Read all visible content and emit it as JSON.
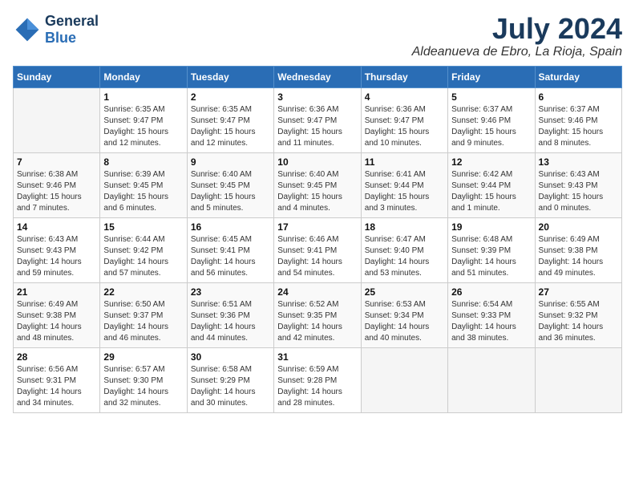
{
  "header": {
    "logo_line1": "General",
    "logo_line2": "Blue",
    "month_year": "July 2024",
    "location": "Aldeanueva de Ebro, La Rioja, Spain"
  },
  "days_of_week": [
    "Sunday",
    "Monday",
    "Tuesday",
    "Wednesday",
    "Thursday",
    "Friday",
    "Saturday"
  ],
  "weeks": [
    [
      {
        "num": "",
        "sunrise": "",
        "sunset": "",
        "daylight": ""
      },
      {
        "num": "1",
        "sunrise": "Sunrise: 6:35 AM",
        "sunset": "Sunset: 9:47 PM",
        "daylight": "Daylight: 15 hours and 12 minutes."
      },
      {
        "num": "2",
        "sunrise": "Sunrise: 6:35 AM",
        "sunset": "Sunset: 9:47 PM",
        "daylight": "Daylight: 15 hours and 12 minutes."
      },
      {
        "num": "3",
        "sunrise": "Sunrise: 6:36 AM",
        "sunset": "Sunset: 9:47 PM",
        "daylight": "Daylight: 15 hours and 11 minutes."
      },
      {
        "num": "4",
        "sunrise": "Sunrise: 6:36 AM",
        "sunset": "Sunset: 9:47 PM",
        "daylight": "Daylight: 15 hours and 10 minutes."
      },
      {
        "num": "5",
        "sunrise": "Sunrise: 6:37 AM",
        "sunset": "Sunset: 9:46 PM",
        "daylight": "Daylight: 15 hours and 9 minutes."
      },
      {
        "num": "6",
        "sunrise": "Sunrise: 6:37 AM",
        "sunset": "Sunset: 9:46 PM",
        "daylight": "Daylight: 15 hours and 8 minutes."
      }
    ],
    [
      {
        "num": "7",
        "sunrise": "Sunrise: 6:38 AM",
        "sunset": "Sunset: 9:46 PM",
        "daylight": "Daylight: 15 hours and 7 minutes."
      },
      {
        "num": "8",
        "sunrise": "Sunrise: 6:39 AM",
        "sunset": "Sunset: 9:45 PM",
        "daylight": "Daylight: 15 hours and 6 minutes."
      },
      {
        "num": "9",
        "sunrise": "Sunrise: 6:40 AM",
        "sunset": "Sunset: 9:45 PM",
        "daylight": "Daylight: 15 hours and 5 minutes."
      },
      {
        "num": "10",
        "sunrise": "Sunrise: 6:40 AM",
        "sunset": "Sunset: 9:45 PM",
        "daylight": "Daylight: 15 hours and 4 minutes."
      },
      {
        "num": "11",
        "sunrise": "Sunrise: 6:41 AM",
        "sunset": "Sunset: 9:44 PM",
        "daylight": "Daylight: 15 hours and 3 minutes."
      },
      {
        "num": "12",
        "sunrise": "Sunrise: 6:42 AM",
        "sunset": "Sunset: 9:44 PM",
        "daylight": "Daylight: 15 hours and 1 minute."
      },
      {
        "num": "13",
        "sunrise": "Sunrise: 6:43 AM",
        "sunset": "Sunset: 9:43 PM",
        "daylight": "Daylight: 15 hours and 0 minutes."
      }
    ],
    [
      {
        "num": "14",
        "sunrise": "Sunrise: 6:43 AM",
        "sunset": "Sunset: 9:43 PM",
        "daylight": "Daylight: 14 hours and 59 minutes."
      },
      {
        "num": "15",
        "sunrise": "Sunrise: 6:44 AM",
        "sunset": "Sunset: 9:42 PM",
        "daylight": "Daylight: 14 hours and 57 minutes."
      },
      {
        "num": "16",
        "sunrise": "Sunrise: 6:45 AM",
        "sunset": "Sunset: 9:41 PM",
        "daylight": "Daylight: 14 hours and 56 minutes."
      },
      {
        "num": "17",
        "sunrise": "Sunrise: 6:46 AM",
        "sunset": "Sunset: 9:41 PM",
        "daylight": "Daylight: 14 hours and 54 minutes."
      },
      {
        "num": "18",
        "sunrise": "Sunrise: 6:47 AM",
        "sunset": "Sunset: 9:40 PM",
        "daylight": "Daylight: 14 hours and 53 minutes."
      },
      {
        "num": "19",
        "sunrise": "Sunrise: 6:48 AM",
        "sunset": "Sunset: 9:39 PM",
        "daylight": "Daylight: 14 hours and 51 minutes."
      },
      {
        "num": "20",
        "sunrise": "Sunrise: 6:49 AM",
        "sunset": "Sunset: 9:38 PM",
        "daylight": "Daylight: 14 hours and 49 minutes."
      }
    ],
    [
      {
        "num": "21",
        "sunrise": "Sunrise: 6:49 AM",
        "sunset": "Sunset: 9:38 PM",
        "daylight": "Daylight: 14 hours and 48 minutes."
      },
      {
        "num": "22",
        "sunrise": "Sunrise: 6:50 AM",
        "sunset": "Sunset: 9:37 PM",
        "daylight": "Daylight: 14 hours and 46 minutes."
      },
      {
        "num": "23",
        "sunrise": "Sunrise: 6:51 AM",
        "sunset": "Sunset: 9:36 PM",
        "daylight": "Daylight: 14 hours and 44 minutes."
      },
      {
        "num": "24",
        "sunrise": "Sunrise: 6:52 AM",
        "sunset": "Sunset: 9:35 PM",
        "daylight": "Daylight: 14 hours and 42 minutes."
      },
      {
        "num": "25",
        "sunrise": "Sunrise: 6:53 AM",
        "sunset": "Sunset: 9:34 PM",
        "daylight": "Daylight: 14 hours and 40 minutes."
      },
      {
        "num": "26",
        "sunrise": "Sunrise: 6:54 AM",
        "sunset": "Sunset: 9:33 PM",
        "daylight": "Daylight: 14 hours and 38 minutes."
      },
      {
        "num": "27",
        "sunrise": "Sunrise: 6:55 AM",
        "sunset": "Sunset: 9:32 PM",
        "daylight": "Daylight: 14 hours and 36 minutes."
      }
    ],
    [
      {
        "num": "28",
        "sunrise": "Sunrise: 6:56 AM",
        "sunset": "Sunset: 9:31 PM",
        "daylight": "Daylight: 14 hours and 34 minutes."
      },
      {
        "num": "29",
        "sunrise": "Sunrise: 6:57 AM",
        "sunset": "Sunset: 9:30 PM",
        "daylight": "Daylight: 14 hours and 32 minutes."
      },
      {
        "num": "30",
        "sunrise": "Sunrise: 6:58 AM",
        "sunset": "Sunset: 9:29 PM",
        "daylight": "Daylight: 14 hours and 30 minutes."
      },
      {
        "num": "31",
        "sunrise": "Sunrise: 6:59 AM",
        "sunset": "Sunset: 9:28 PM",
        "daylight": "Daylight: 14 hours and 28 minutes."
      },
      {
        "num": "",
        "sunrise": "",
        "sunset": "",
        "daylight": ""
      },
      {
        "num": "",
        "sunrise": "",
        "sunset": "",
        "daylight": ""
      },
      {
        "num": "",
        "sunrise": "",
        "sunset": "",
        "daylight": ""
      }
    ]
  ]
}
